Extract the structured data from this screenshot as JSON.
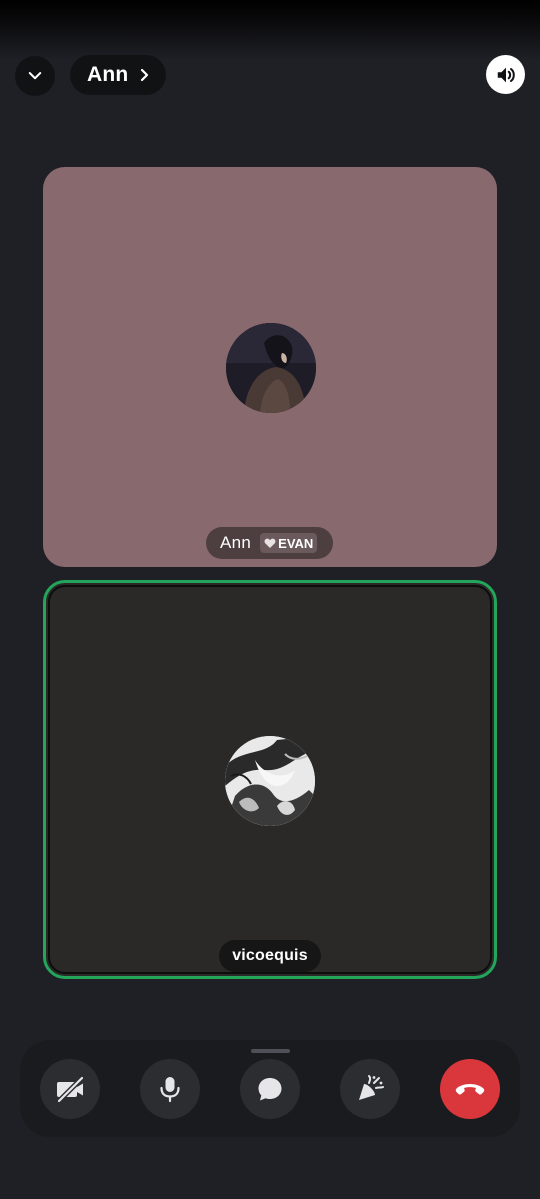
{
  "header": {
    "title": "Ann",
    "collapse_icon": "chevron-down-icon",
    "title_icon": "chevron-right-icon",
    "speaker_icon": "speaker-icon"
  },
  "participants": [
    {
      "name": "Ann",
      "badge_icon": "heart-icon",
      "badge_text": "EVAN",
      "tile_color": "#886a6e"
    },
    {
      "name": "vicoequis",
      "tile_color": "#2a2928",
      "speaking_ring_color": "#23a55a"
    }
  ],
  "controls": [
    {
      "name": "camera-off",
      "icon": "video-off-icon"
    },
    {
      "name": "microphone",
      "icon": "mic-icon"
    },
    {
      "name": "chat",
      "icon": "chat-bubble-icon"
    },
    {
      "name": "activities",
      "icon": "rocket-icon"
    },
    {
      "name": "hang-up",
      "icon": "phone-hangup-icon",
      "color": "#da373c"
    }
  ]
}
